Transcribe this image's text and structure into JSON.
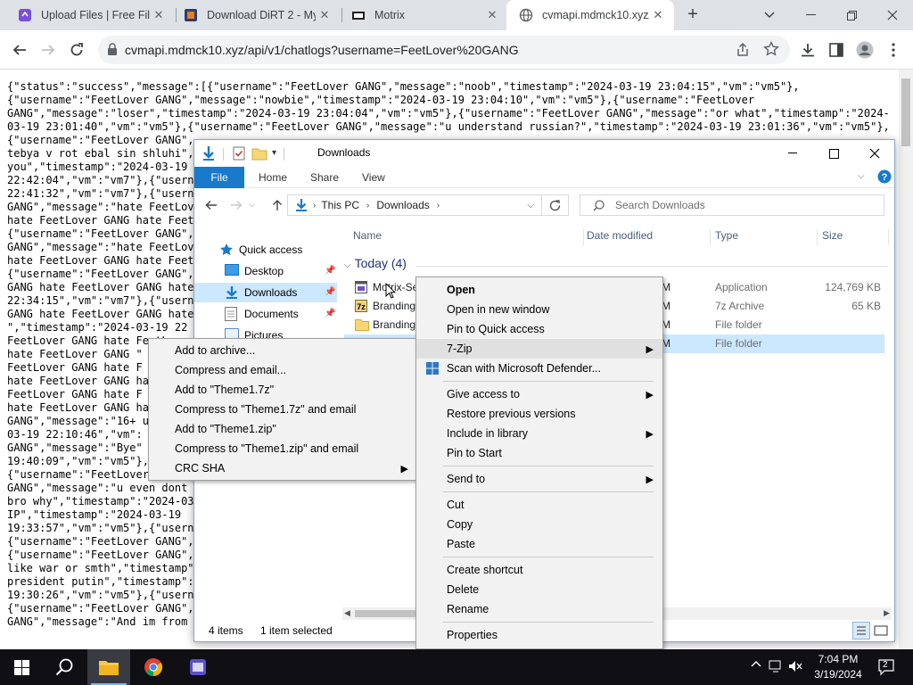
{
  "browser": {
    "tabs": [
      {
        "title": "Upload Files | Free File",
        "active": false
      },
      {
        "title": "Download DiRT 2 - My",
        "active": false
      },
      {
        "title": "Motrix",
        "active": false
      },
      {
        "title": "cvmapi.mdmck10.xyz/a",
        "active": true
      }
    ],
    "url": "cvmapi.mdmck10.xyz/api/v1/chatlogs?username=FeetLover%20GANG"
  },
  "page": {
    "json_lines": [
      "{\"status\":\"success\",\"message\":[{\"username\":\"FeetLover GANG\",\"message\":\"noob\",\"timestamp\":\"2024-03-19 23:04:15\",\"vm\":\"vm5\"},",
      "{\"username\":\"FeetLover GANG\",\"message\":\"nowbie\",\"timestamp\":\"2024-03-19 23:04:10\",\"vm\":\"vm5\"},{\"username\":\"FeetLover",
      "GANG\",\"message\":\"loser\",\"timestamp\":\"2024-03-19 23:04:04\",\"vm\":\"vm5\"},{\"username\":\"FeetLover GANG\",\"message\":\"or what\",\"timestamp\":\"2024-",
      "03-19 23:01:40\",\"vm\":\"vm5\"},{\"username\":\"FeetLover GANG\",\"message\":\"u understand russian?\",\"timestamp\":\"2024-03-19 23:01:36\",\"vm\":\"vm5\"},",
      "{\"username\":\"FeetLover GANG\",",
      "tebya v rot ebal sin shluhi\",",
      "you\",\"timestamp\":\"2024-03-19 2",
      "22:42:04\",\"vm\":\"vm7\"},{\"userna",
      "22:41:32\",\"vm\":\"vm7\"},{\"userna",
      "GANG\",\"message\":\"hate FeetLove",
      "hate FeetLover GANG hate Feet",
      "{\"username\":\"FeetLover GANG\",",
      "GANG\",\"message\":\"hate FeetLove",
      "hate FeetLover GANG hate Feet",
      "{\"username\":\"FeetLover GANG\",",
      "GANG hate FeetLover GANG hate",
      "22:34:15\",\"vm\":\"vm7\"},{\"userna",
      "GANG hate FeetLover GANG hate",
      "\",\"timestamp\":\"2024-03-19 22",
      "FeetLover GANG hate FeetLover",
      "hate FeetLover GANG \"",
      "FeetLover GANG hate F",
      "hate FeetLover GANG ha",
      "FeetLover GANG hate F",
      "hate FeetLover GANG ha",
      "GANG\",\"message\":\"16+ u",
      "03-19 22:10:46\",\"vm\":",
      "GANG\",\"message\":\"Bye\"",
      "19:40:09\",\"vm\":\"vm5\"},",
      "{\"username\":\"FeetLover GANG\",",
      "GANG\",\"message\":\"u even dont h",
      "bro why\",\"timestamp\":\"2024-03",
      "IP\",\"timestamp\":\"2024-03-19",
      "19:33:57\",\"vm\":\"vm5\"},{\"usern",
      "{\"username\":\"FeetLover GANG\",",
      "{\"username\":\"FeetLover GANG\",",
      "like war or smth\",\"timestamp\"",
      "president putin\",\"timestamp\":",
      "19:30:26\",\"vm\":\"vm5\"},{\"usern",
      "{\"username\":\"FeetLover GANG\",",
      "GANG\",\"message\":\"And im from"
    ]
  },
  "explorer": {
    "title": "Downloads",
    "ribbon_tabs": [
      "File",
      "Home",
      "Share",
      "View"
    ],
    "breadcrumb": [
      "This PC",
      "Downloads"
    ],
    "search_placeholder": "Search Downloads",
    "nav": [
      {
        "label": "Quick access"
      },
      {
        "label": "Desktop"
      },
      {
        "label": "Downloads"
      },
      {
        "label": "Documents"
      },
      {
        "label": "Pictures"
      }
    ],
    "columns": [
      "Name",
      "Date modified",
      "Type",
      "Size"
    ],
    "group": "Today (4)",
    "files": [
      {
        "name": "Motrix-Se",
        "date": "M",
        "type": "Application",
        "size": "124,769 KB"
      },
      {
        "name": "Branding",
        "date": "M",
        "type": "7z Archive",
        "size": "65 KB"
      },
      {
        "name": "Branding",
        "date": "M",
        "type": "File folder",
        "size": ""
      },
      {
        "name": "",
        "date": "M",
        "type": "File folder",
        "size": ""
      }
    ],
    "status_items": "4 items",
    "status_selected": "1 item selected"
  },
  "context_menu": {
    "items": [
      {
        "label": "Open",
        "bold": true
      },
      {
        "label": "Open in new window"
      },
      {
        "label": "Pin to Quick access"
      },
      {
        "label": "7-Zip",
        "submenu": true
      },
      {
        "label": "Scan with Microsoft Defender..."
      },
      {
        "label": "Give access to",
        "submenu": true
      },
      {
        "label": "Restore previous versions"
      },
      {
        "label": "Include in library",
        "submenu": true
      },
      {
        "label": "Pin to Start"
      },
      {
        "label": "Send to",
        "submenu": true
      },
      {
        "label": "Cut"
      },
      {
        "label": "Copy"
      },
      {
        "label": "Paste"
      },
      {
        "label": "Create shortcut"
      },
      {
        "label": "Delete"
      },
      {
        "label": "Rename"
      },
      {
        "label": "Properties"
      }
    ]
  },
  "zip_menu": {
    "items": [
      {
        "label": "Add to archive..."
      },
      {
        "label": "Compress and email..."
      },
      {
        "label": "Add to \"Theme1.7z\""
      },
      {
        "label": "Compress to \"Theme1.7z\" and email"
      },
      {
        "label": "Add to \"Theme1.zip\""
      },
      {
        "label": "Compress to \"Theme1.zip\" and email"
      },
      {
        "label": "CRC SHA",
        "submenu": true
      }
    ]
  },
  "taskbar": {
    "time": "7:04 PM",
    "date": "3/19/2024",
    "notifications": "2"
  },
  "colors": {
    "accent": "#1979ca",
    "selection": "#cce8ff",
    "taskbar": "#0f0f14"
  }
}
